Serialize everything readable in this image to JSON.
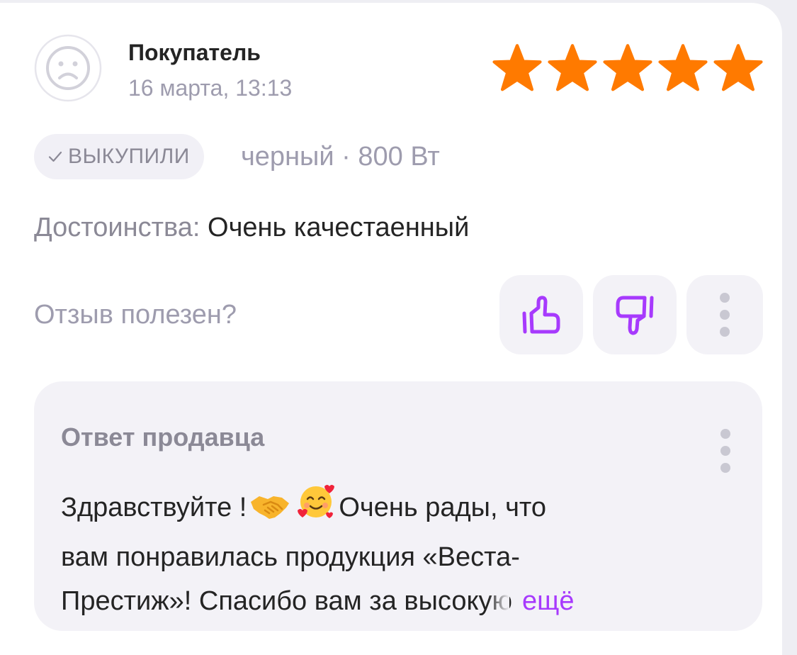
{
  "review": {
    "author": "Покупатель",
    "date": "16 марта, 13:13",
    "rating": 5,
    "rating_max": 5,
    "badge_label": "ВЫКУПИЛИ",
    "variant": "черный · 800 Вт",
    "pros_label": "Достоинства:",
    "pros_text": "Очень качестаенный",
    "helpful_question": "Отзыв полезен?"
  },
  "seller_reply": {
    "title": "Ответ продавца",
    "line1_part1": "Здравствуйте !",
    "line1_part2": "Очень рады, что",
    "line2": "вам понравилась продукция «Веста-",
    "line3": "Престиж»! Спасибо вам за высокую",
    "more_label": "ещё"
  },
  "colors": {
    "star": "#ff7a00",
    "accent": "#a73afd",
    "muted_text": "#9e9cae",
    "label_text": "#8b8996",
    "panel_bg": "#f3f2f7"
  },
  "icons": {
    "avatar": "sad-face-avatar-icon",
    "like": "thumbs-up-icon",
    "dislike": "thumbs-down-icon",
    "more": "more-vertical-icon",
    "badge": "check-icon",
    "emoji1": "handshake-emoji",
    "emoji2": "smiling-face-with-hearts-emoji"
  }
}
